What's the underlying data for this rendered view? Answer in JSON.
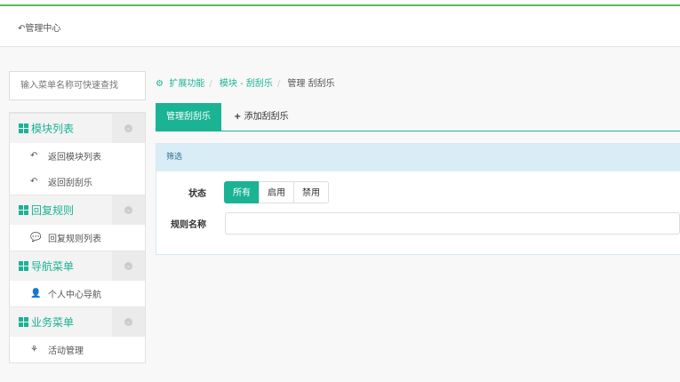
{
  "header": {
    "back_label": "管理中心",
    "accent": "#5cb85c"
  },
  "sidebar": {
    "search_placeholder": "输入菜单名称可快速查找",
    "groups": [
      {
        "title": "模块列表",
        "items": [
          {
            "icon": "reply-icon",
            "label": "返回模块列表"
          },
          {
            "icon": "reply-icon",
            "label": "返回刮刮乐"
          }
        ]
      },
      {
        "title": "回复规则",
        "items": [
          {
            "icon": "comments-icon",
            "label": "回复规则列表"
          }
        ]
      },
      {
        "title": "导航菜单",
        "items": [
          {
            "icon": "user-icon",
            "label": "个人中心导航"
          }
        ]
      },
      {
        "title": "业务菜单",
        "items": [
          {
            "icon": "activity-icon",
            "label": "活动管理"
          }
        ]
      }
    ]
  },
  "breadcrumb": {
    "items": [
      "扩展功能",
      "模块 - 刮刮乐"
    ],
    "current": "管理 刮刮乐"
  },
  "tabs": {
    "active": "管理刮刮乐",
    "add": "添加刮刮乐"
  },
  "filter": {
    "heading": "筛选",
    "status_label": "状态",
    "status_options": [
      "所有",
      "启用",
      "禁用"
    ],
    "status_selected": "所有",
    "name_label": "规则名称",
    "name_value": ""
  },
  "colors": {
    "primary": "#1ab394",
    "panel_heading": "#d9edf7"
  }
}
